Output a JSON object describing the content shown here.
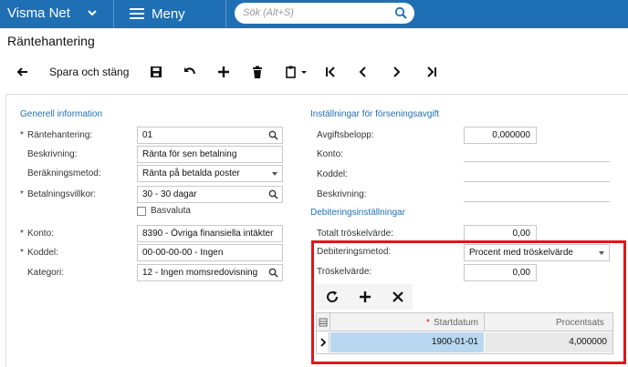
{
  "topbar": {
    "brand": "Visma Net",
    "menu_label": "Meny",
    "search_placeholder": "Sök (Alt+S)"
  },
  "page": {
    "title": "Räntehantering"
  },
  "toolbar": {
    "back_icon": "arrow-left-icon",
    "save_close_label": "Spara och stäng",
    "icons": [
      "save-icon",
      "undo-icon",
      "plus-icon",
      "trash-icon",
      "clipboard-icon",
      "first-icon",
      "prev-icon",
      "next-icon",
      "last-icon"
    ]
  },
  "general": {
    "section_title": "Generell information",
    "interest_code_label": "Räntehantering:",
    "interest_code_value": "01",
    "description_label": "Beskrivning:",
    "description_value": "Ränta för sen betalning",
    "calc_method_label": "Beräkningsmetod:",
    "calc_method_value": "Ränta på betalda poster",
    "terms_label": "Betalningsvillkor:",
    "terms_value": "30 - 30 dagar",
    "base_currency_label": "Basvaluta",
    "base_currency_checked": false,
    "account_label": "Konto:",
    "account_value": "8390 - Övriga finansiella intäkter",
    "subaccount_label": "Koddel:",
    "subaccount_value": "00-00-00-00 - Ingen",
    "category_label": "Kategori:",
    "category_value": "12 - Ingen momsredovisning"
  },
  "late_fee": {
    "section_title": "Inställningar för förseningsavgift",
    "fee_amount_label": "Avgiftsbelopp:",
    "fee_amount_value": "0,000000",
    "account_label": "Konto:",
    "subaccount_label": "Koddel:",
    "description_label": "Beskrivning:"
  },
  "debit": {
    "section_title": "Debiteringsinställningar",
    "total_threshold_label": "Totalt tröskelvärde:",
    "total_threshold_value": "0,00",
    "method_label": "Debiteringsmetod:",
    "method_value": "Procent med tröskelvärde",
    "threshold_label": "Tröskelvärde:",
    "threshold_value": "0,00"
  },
  "grid": {
    "required_mark": "*",
    "col_start_date": "Startdatum",
    "col_percent": "Procentsats",
    "rows": [
      {
        "start_date": "1900-01-01",
        "percent": "4,000000"
      }
    ]
  },
  "colors": {
    "topbar": "#1f6fb5",
    "section": "#1f6fb5",
    "highlight": "#e0161b",
    "row_selected": "#b9d7f0"
  }
}
